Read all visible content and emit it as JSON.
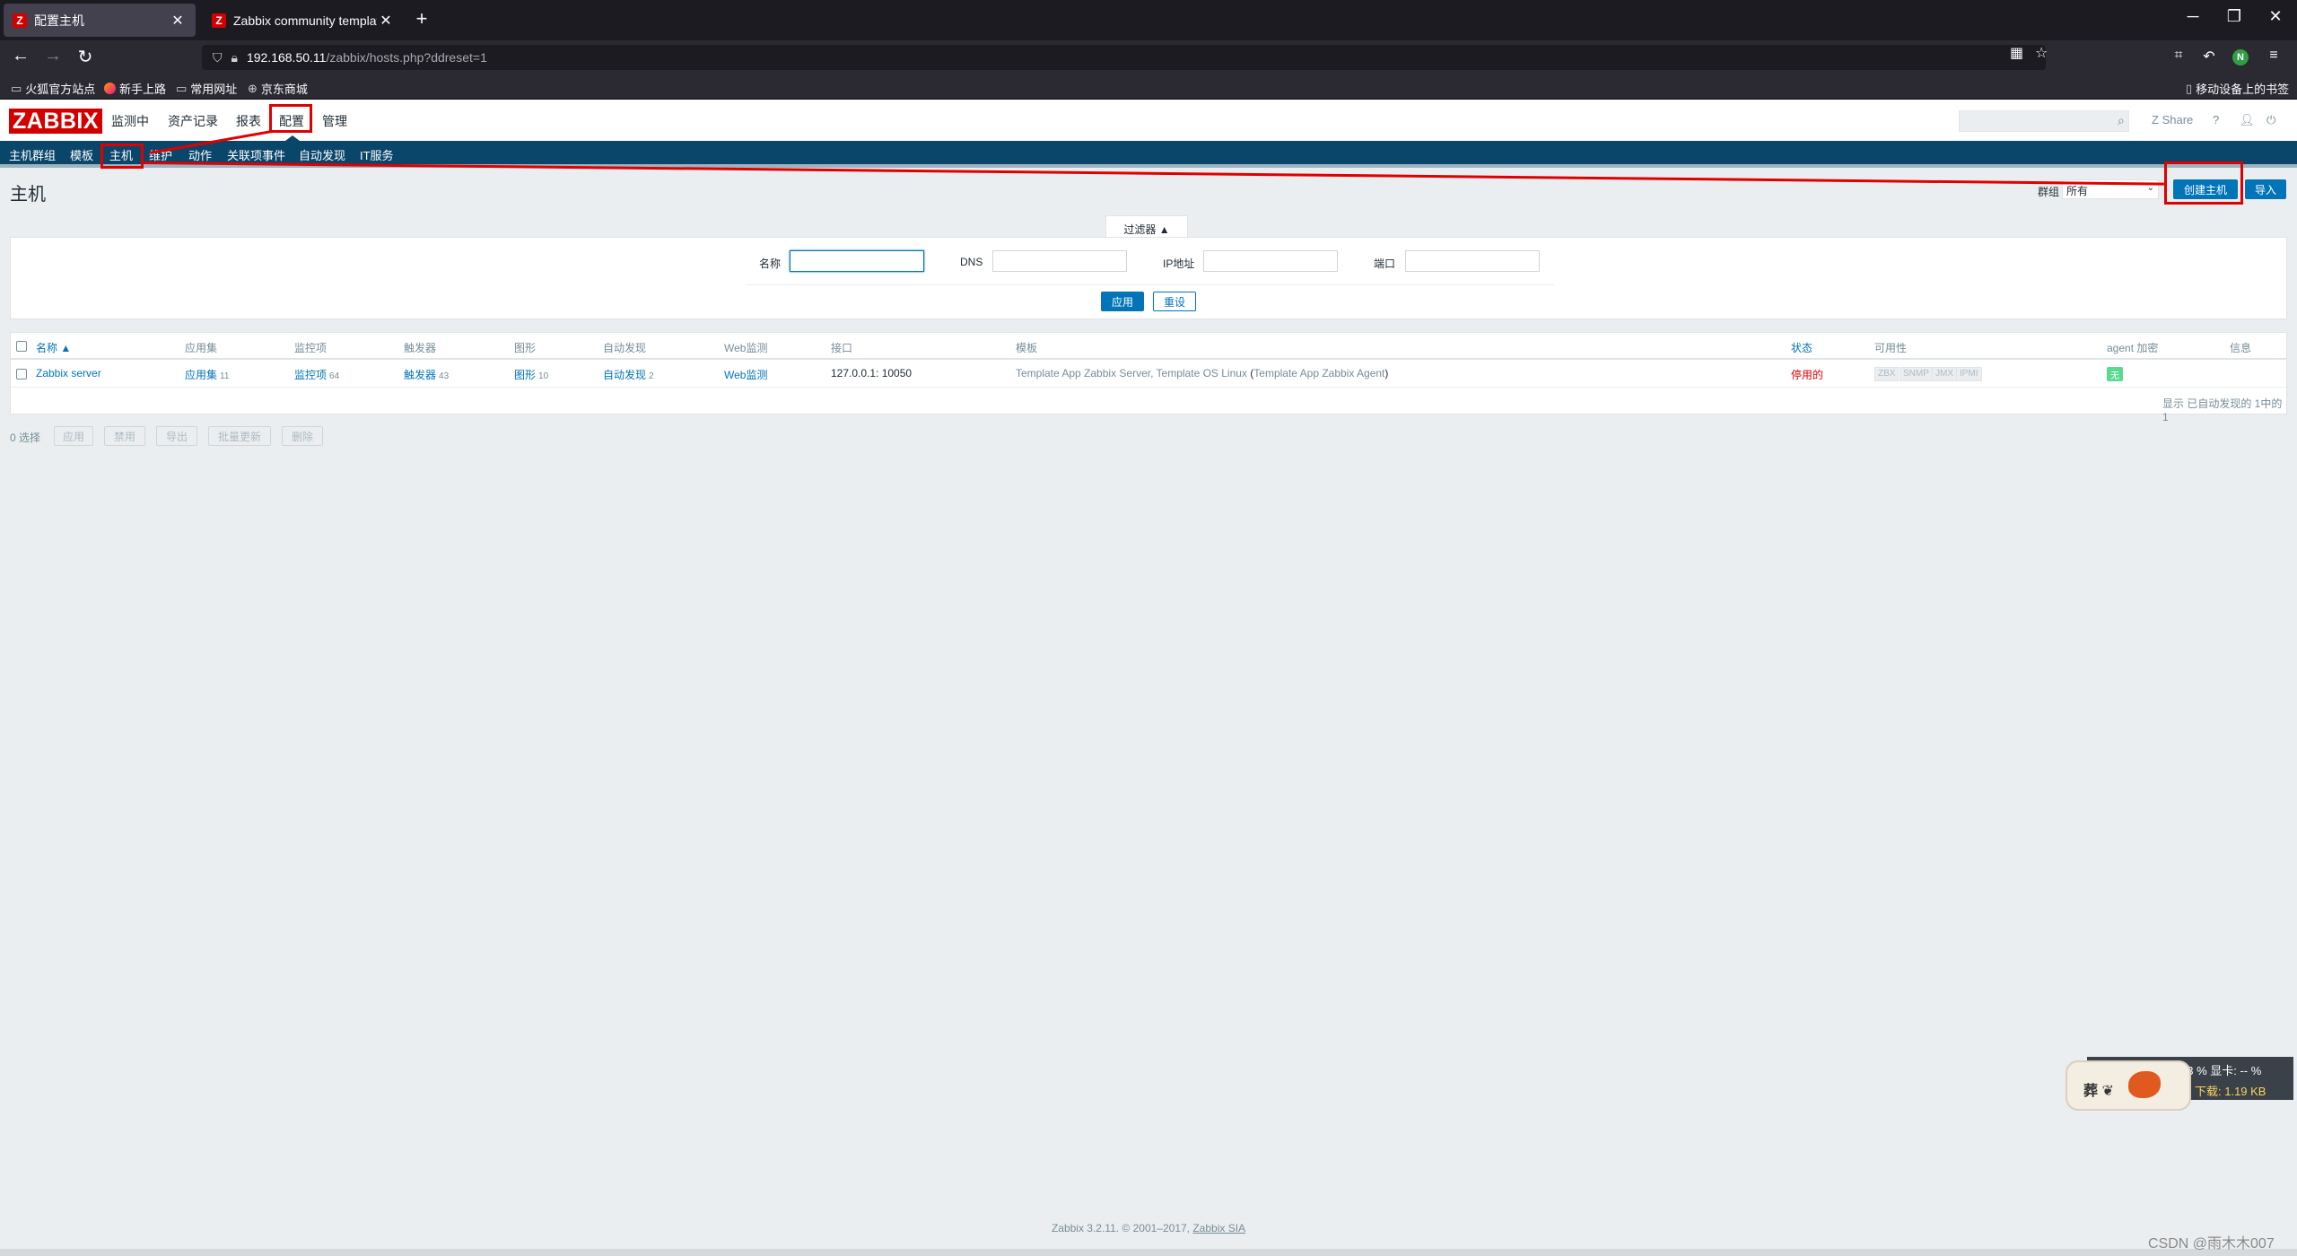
{
  "browser": {
    "tabs": [
      {
        "title": "配置主机",
        "favicon": "Z",
        "active": true
      },
      {
        "title": "Zabbix community templates",
        "favicon": "Z",
        "active": false
      }
    ],
    "url_host": "192.168.50.11",
    "url_path": "/zabbix/hosts.php?ddreset=1",
    "bookmarks": [
      "火狐官方站点",
      "新手上路",
      "常用网址",
      "京东商城"
    ],
    "mobile_bookmarks": "移动设备上的书签"
  },
  "zabbix": {
    "logo": "ZABBIX",
    "main_menu": [
      "监测中",
      "资产记录",
      "报表",
      "配置",
      "管理"
    ],
    "selected_menu": "配置",
    "share": "Share",
    "help": "?",
    "sub_menu": [
      "主机群组",
      "模板",
      "主机",
      "维护",
      "动作",
      "关联项事件",
      "自动发现",
      "IT服务"
    ],
    "selected_sub": "主机"
  },
  "page": {
    "title": "主机",
    "group_label": "群组",
    "group_value": "所有",
    "create_button": "创建主机",
    "import_button": "导入"
  },
  "filter": {
    "tab_label": "过滤器 ▲",
    "name_label": "名称",
    "dns_label": "DNS",
    "ip_label": "IP地址",
    "port_label": "端口",
    "name_value": "",
    "dns_value": "",
    "ip_value": "",
    "port_value": "",
    "apply": "应用",
    "reset": "重设"
  },
  "table": {
    "headers": {
      "name": "名称 ▲",
      "applications": "应用集",
      "items": "监控项",
      "triggers": "触发器",
      "graphs": "图形",
      "discovery": "自动发现",
      "web": "Web监测",
      "interface": "接口",
      "templates": "模板",
      "status": "状态",
      "availability": "可用性",
      "encryption": "agent 加密",
      "info": "信息"
    },
    "rows": [
      {
        "name": "Zabbix server",
        "applications": "应用集",
        "applications_count": "11",
        "items": "监控项",
        "items_count": "64",
        "triggers": "触发器",
        "triggers_count": "43",
        "graphs": "图形",
        "graphs_count": "10",
        "discovery": "自动发现",
        "discovery_count": "2",
        "web": "Web监测",
        "interface": "127.0.0.1: 10050",
        "template_1": "Template App Zabbix Server",
        "template_sep": ", ",
        "template_2": "Template OS Linux",
        "template_paren_open": " (",
        "template_3": "Template App Zabbix Agent",
        "template_paren_close": ")",
        "status": "停用的",
        "avail": [
          "ZBX",
          "SNMP",
          "JMX",
          "IPMI"
        ],
        "encryption": "无"
      }
    ],
    "footer": "显示 已自动发现的 1中的1"
  },
  "mass": {
    "selected": "0 选择",
    "buttons": [
      "应用",
      "禁用",
      "导出",
      "批量更新",
      "删除"
    ]
  },
  "footer": {
    "text": "Zabbix 3.2.11. © 2001–2017, ",
    "link": "Zabbix SIA"
  },
  "widget": {
    "top_line": "43 %    显卡: -- %",
    "download": "下载: 1.19 KB",
    "cat_text": "葬 ❦"
  },
  "watermark": "CSDN @雨木木007"
}
